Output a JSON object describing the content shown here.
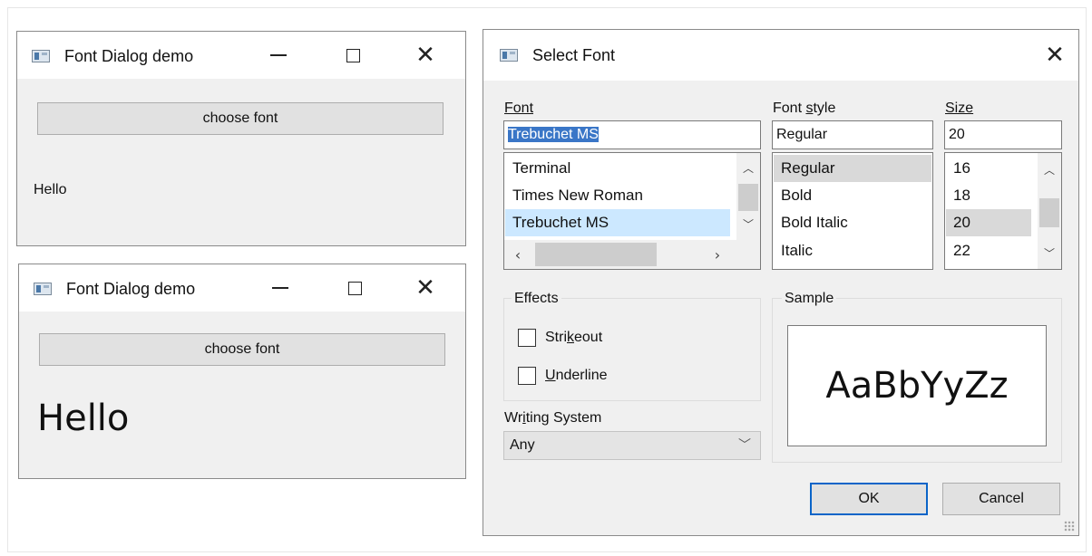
{
  "window_top": {
    "title": "Font Dialog demo",
    "choose_button": "choose font",
    "label": "Hello"
  },
  "window_bottom": {
    "title": "Font Dialog demo",
    "choose_button": "choose font",
    "label": "Hello"
  },
  "dialog": {
    "title": "Select Font",
    "font": {
      "label": "Font",
      "value": "Trebuchet MS",
      "items": [
        "Terminal",
        "Times New Roman",
        "Trebuchet MS"
      ],
      "selected": "Trebuchet MS"
    },
    "style": {
      "label": "Font style",
      "value": "Regular",
      "items": [
        "Regular",
        "Bold",
        "Bold Italic",
        "Italic"
      ],
      "selected": "Regular"
    },
    "size": {
      "label": "Size",
      "value": "20",
      "items": [
        "16",
        "18",
        "20",
        "22"
      ],
      "selected": "20"
    },
    "effects": {
      "title": "Effects",
      "strikeout": "Strikeout",
      "underline": "Underline",
      "strikeout_checked": false,
      "underline_checked": false
    },
    "sample": {
      "title": "Sample",
      "text": "AaBbYyZz"
    },
    "writing_system": {
      "label": "Writing System",
      "value": "Any"
    },
    "ok": "OK",
    "cancel": "Cancel"
  },
  "colors": {
    "selection": "#3a76c7",
    "list_selected": "#cce8ff",
    "default_button_border": "#0a64c8"
  },
  "icons": [
    "app-icon",
    "minimize-icon",
    "maximize-icon",
    "close-icon",
    "chevron-up-icon",
    "chevron-down-icon",
    "chevron-left-icon",
    "chevron-right-icon"
  ]
}
